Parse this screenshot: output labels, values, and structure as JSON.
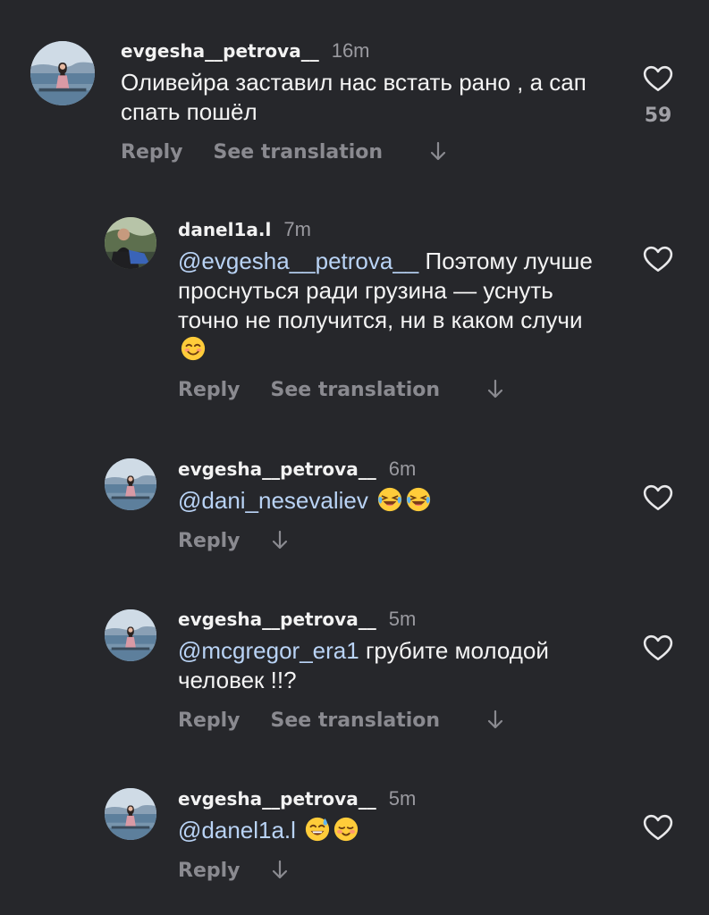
{
  "colors": {
    "background": "#26272b",
    "mention": "#b9d3f5",
    "action_text": "#8a8a90",
    "secondary_text": "#9a9aa0"
  },
  "comments": [
    {
      "username": "evgesha__petrova__",
      "time": "16m",
      "text": "Оливейра заставил нас встать рано , а сап спать пошёл",
      "reply_label": "Reply",
      "translation_label": "See translation",
      "like_count": "59",
      "icons": [
        "avatar-photo-icon",
        "heart-outline-icon",
        "arrow-down-icon"
      ]
    },
    {
      "username": "danel1a.l",
      "time": "7m",
      "mention": "@evgesha__petrova__",
      "text": "Поэтому лучше проснуться ради грузина — уснуть точно не получится, ни в каком случи",
      "emoji": "😊",
      "reply_label": "Reply",
      "translation_label": "See translation",
      "icons": [
        "avatar-photo-icon",
        "heart-outline-icon",
        "smiling-face-emoji",
        "arrow-down-icon"
      ]
    },
    {
      "username": "evgesha__petrova__",
      "time": "6m",
      "mention": "@dani_nesevaliev",
      "emoji": "😂😂",
      "reply_label": "Reply",
      "icons": [
        "avatar-photo-icon",
        "heart-outline-icon",
        "tears-of-joy-emoji",
        "arrow-down-icon"
      ]
    },
    {
      "username": "evgesha__petrova__",
      "time": "5m",
      "mention": "@mcgregor_era1",
      "text": "грубите молодой человек !!?",
      "reply_label": "Reply",
      "translation_label": "See translation",
      "icons": [
        "avatar-photo-icon",
        "heart-outline-icon",
        "arrow-down-icon"
      ]
    },
    {
      "username": "evgesha__petrova__",
      "time": "5m",
      "mention": "@danel1a.l",
      "emoji": "😅☺️",
      "reply_label": "Reply",
      "icons": [
        "avatar-photo-icon",
        "heart-outline-icon",
        "sweat-smile-emoji",
        "blushing-face-emoji",
        "arrow-down-icon"
      ]
    }
  ]
}
